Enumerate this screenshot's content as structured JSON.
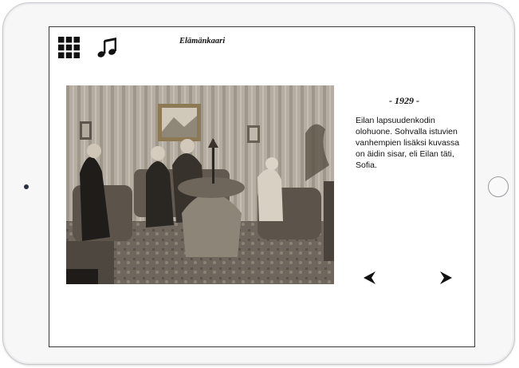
{
  "app": {
    "title": "Elämänkaari"
  },
  "toolbar": {
    "menu_icon": "grid-menu-icon",
    "music_icon": "music-note-icon"
  },
  "photo": {
    "subject": "family-living-room-photo"
  },
  "entry": {
    "year": "- 1929 -",
    "caption": "Eilan lapsuudenkodin olohuone. Sohvalla istuvien vanhempien lisäksi kuvassa on äidin sisar, eli Eilan täti, Sofia."
  },
  "navigation": {
    "prev_icon": "arrow-left-icon",
    "next_icon": "arrow-right-icon"
  },
  "colors": {
    "text": "#111111",
    "screen_border": "#3a3a3a",
    "device_frame": "#f7f7f8"
  }
}
